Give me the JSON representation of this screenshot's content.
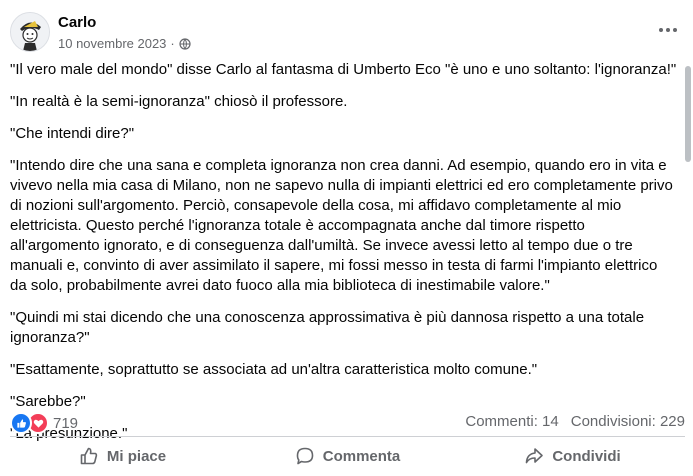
{
  "post": {
    "author": "Carlo",
    "date": "10 novembre 2023",
    "separator": "·",
    "privacy_icon": "globe-icon",
    "paragraphs": [
      "\"Il vero male del mondo\" disse Carlo al fantasma di Umberto Eco \"è uno e uno soltanto: l'ignoranza!\"",
      "\"In realtà è la semi-ignoranza\" chiosò il professore.",
      "\"Che intendi dire?\"",
      "\"Intendo dire che una sana e completa ignoranza non crea danni. Ad esempio, quando ero in vita e vivevo nella mia casa di Milano, non ne sapevo nulla di impianti elettrici ed ero completamente privo di nozioni sull'argomento. Perciò, consapevole della cosa, mi affidavo completamente al mio elettricista. Questo perché l'ignoranza totale è accompagnata anche dal timore rispetto all'argomento ignorato, e di conseguenza dall'umiltà. Se invece avessi letto al tempo due o tre manuali e, convinto di aver assimilato il sapere, mi fossi messo in testa di farmi l'impianto elettrico da solo, probabilmente avrei dato fuoco alla mia biblioteca di inestimabile valore.\"",
      "\"Quindi mi stai dicendo che una conoscenza approssimativa è più dannosa rispetto a una totale ignoranza?\"",
      "\"Esattamente, soprattutto se associata ad un'altra caratteristica molto comune.\"",
      "\"Sarebbe?\"",
      "\"La presunzione.\""
    ]
  },
  "stats": {
    "reaction_icons": [
      "like-icon",
      "love-icon"
    ],
    "reaction_count": "719",
    "comments": "Commenti: 14",
    "shares": "Condivisioni: 229"
  },
  "actions": {
    "like": "Mi piace",
    "comment": "Commenta",
    "share": "Condividi"
  },
  "colors": {
    "like_blue": "#1877f2",
    "love_red": "#f33e58",
    "secondary_text": "#65676b"
  }
}
